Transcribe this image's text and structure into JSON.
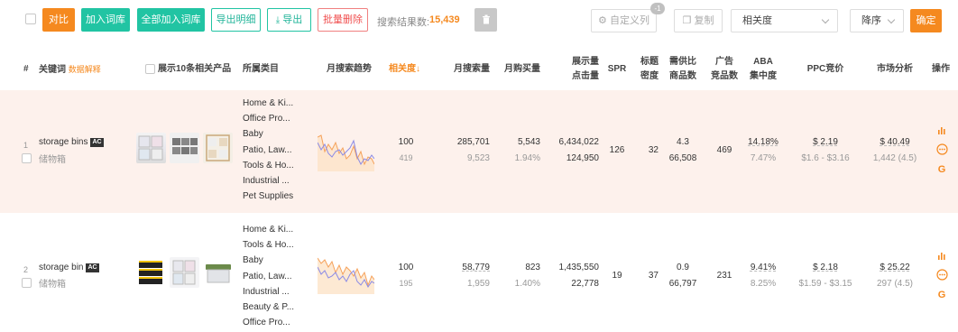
{
  "toolbar": {
    "compare": "对比",
    "add_lexicon": "加入词库",
    "add_all_lexicon": "全部加入词库",
    "export_detail": "导出明细",
    "export": "导出",
    "batch_delete": "批量删除",
    "result_label": "搜索结果数:",
    "result_count": "15,439",
    "custom_columns": "自定义列",
    "custom_columns_badge": "-1",
    "copy": "复制",
    "sort_field": "相关度",
    "sort_order": "降序",
    "confirm": "确定"
  },
  "columns": {
    "index": "#",
    "keyword": "关键词",
    "data_explain": "数据解释",
    "show_products": "展示10条相关产品",
    "category": "所属类目",
    "trend": "月搜索趋势",
    "relevance": "相关度",
    "monthly_search": "月搜索量",
    "monthly_purchase": "月购买量",
    "impressions": "展示量",
    "clicks": "点击量",
    "spr": "SPR",
    "title_density_1": "标题",
    "title_density_2": "密度",
    "supply_demand_1": "需供比",
    "supply_demand_2": "商品数",
    "ad_1": "广告",
    "ad_2": "竞品数",
    "aba_1": "ABA",
    "aba_2": "集中度",
    "ppc": "PPC竞价",
    "market": "市场分析",
    "ops": "操作"
  },
  "rows": [
    {
      "index": "1",
      "keyword": "storage bins",
      "badge": "AC",
      "translation": "储物箱",
      "categories": [
        "Home & Ki...",
        "Office Pro...",
        "Baby",
        "Patio, Law...",
        "Tools & Ho...",
        "Industrial ...",
        "Pet Supplies"
      ],
      "relevance": "100",
      "relevance_sub": "419",
      "monthly_search": "285,701",
      "monthly_search_sub": "9,523",
      "monthly_purchase": "5,543",
      "purchase_rate": "1.94%",
      "impressions": "6,434,022",
      "clicks": "124,950",
      "spr": "126",
      "title_density": "32",
      "supply_demand": "4.3",
      "product_count": "66,508",
      "ad_competitors": "469",
      "aba": "14.18%",
      "aba_sub": "7.47%",
      "ppc": "$ 2.19",
      "ppc_range": "$1.6 - $3.16",
      "market": "$ 40.49",
      "market_sub": "1,442 (4.5)"
    },
    {
      "index": "2",
      "keyword": "storage bin",
      "badge": "AC",
      "translation": "储物箱",
      "categories": [
        "Home & Ki...",
        "Tools & Ho...",
        "Baby",
        "Patio, Law...",
        "Industrial ...",
        "Beauty & P...",
        "Office Pro..."
      ],
      "relevance": "100",
      "relevance_sub": "195",
      "monthly_search": "58,779",
      "monthly_search_sub": "1,959",
      "monthly_purchase": "823",
      "purchase_rate": "1.40%",
      "impressions": "1,435,550",
      "clicks": "22,778",
      "spr": "19",
      "title_density": "37",
      "supply_demand": "0.9",
      "product_count": "66,797",
      "ad_competitors": "231",
      "aba": "9.41%",
      "aba_sub": "8.25%",
      "ppc": "$ 2.18",
      "ppc_range": "$1.59 - $3.15",
      "market": "$ 25.22",
      "market_sub": "297 (4.5)"
    }
  ],
  "icons": {
    "export": "download-icon",
    "trash": "trash-icon",
    "gear": "gear-icon",
    "copy": "copy-icon",
    "chart": "bar-chart-icon",
    "more": "more-icon",
    "google": "google-icon",
    "sort": "arrow-down-icon"
  },
  "colors": {
    "accent": "#f5891f",
    "teal": "#21c4a3",
    "danger": "#f05050",
    "row_highlight": "#fdf1ec",
    "spark_orange": "#f5a15a",
    "spark_purple": "#8a8ae6"
  }
}
